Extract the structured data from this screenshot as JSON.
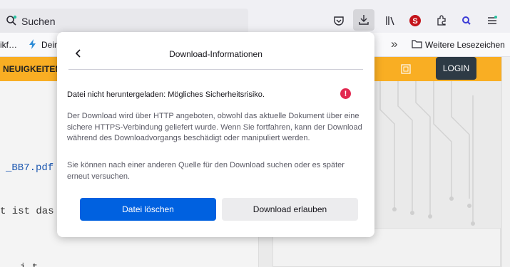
{
  "toolbar": {
    "search_placeholder": "Suchen",
    "icons": [
      "search-icon",
      "pocket-icon",
      "downloads-icon",
      "library-icon",
      "ublock-icon",
      "extensions-icon",
      "account-icon",
      "menu-icon"
    ]
  },
  "bookmarks": {
    "item1": "ikf…",
    "item2": "Dein",
    "overflow": "»",
    "other": "Weitere Lesezeichen"
  },
  "page": {
    "nav_label": "NEUIGKEITEN",
    "login_label": "LOGIN",
    "code_line1": "_BB7.pdf",
    "code_line2": "t ist das",
    "code_line3": "i t"
  },
  "popup": {
    "title": "Download-Informationen",
    "warning": "Datei nicht heruntergeladen: Mögliches Sicherheitsrisiko.",
    "paragraph1": "Der Download wird über HTTP angeboten, obwohl das aktuelle Dokument über eine sichere HTTPS-Verbindung geliefert wurde. Wenn Sie fortfahren, kann der Download während des Downloadvorgangs beschädigt oder manipuliert werden.",
    "paragraph2": "Sie können nach einer anderen Quelle für den Download suchen oder es später erneut versuchen.",
    "delete_button": "Datei löschen",
    "allow_button": "Download erlauben"
  },
  "colors": {
    "accent": "#0061e0",
    "warning": "#e22850",
    "site_orange": "#f9ae23",
    "login_dark": "#2d3a45"
  }
}
